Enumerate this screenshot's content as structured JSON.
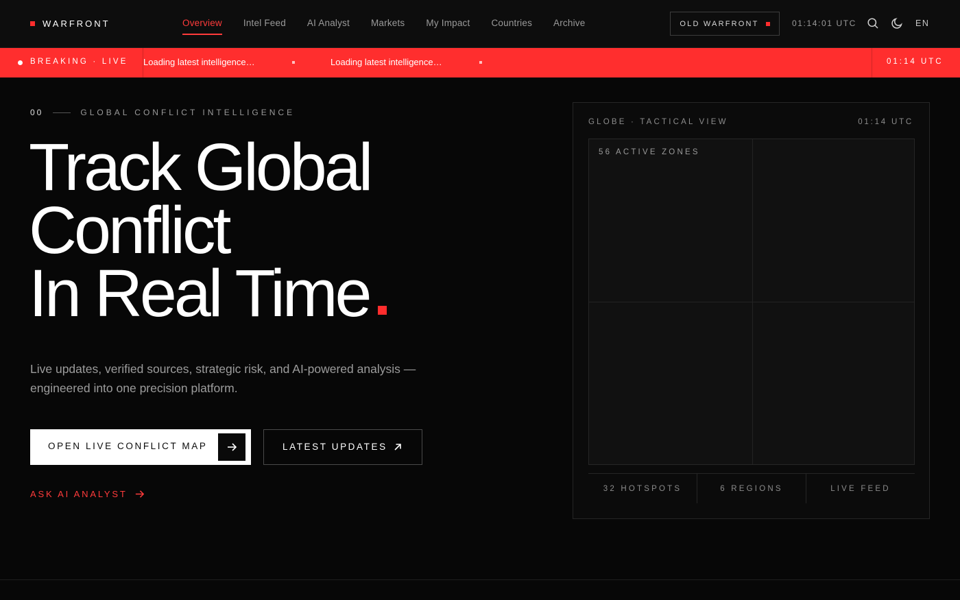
{
  "colors": {
    "accent": "#ff2d2d",
    "background": "#070707",
    "ticker_bg": "#ff2e2e"
  },
  "nav": {
    "brand": "WARFRONT",
    "links": [
      {
        "label": "Overview",
        "active": true
      },
      {
        "label": "Intel Feed",
        "active": false
      },
      {
        "label": "AI Analyst",
        "active": false
      },
      {
        "label": "Markets",
        "active": false
      },
      {
        "label": "My Impact",
        "active": false
      },
      {
        "label": "Countries",
        "active": false
      },
      {
        "label": "Archive",
        "active": false
      }
    ],
    "old_site_button": "OLD WARFRONT",
    "clock": "01:14:01 UTC",
    "icons": [
      "search-icon",
      "moon-icon"
    ],
    "language": "EN"
  },
  "ticker": {
    "label": "BREAKING · LIVE",
    "messages": [
      "Loading latest intelligence…",
      "Loading latest intelligence…"
    ],
    "time": "01:14 UTC"
  },
  "hero": {
    "eyebrow_number": "00",
    "eyebrow_text": "GLOBAL CONFLICT INTELLIGENCE",
    "title_lines": [
      "Track Global",
      "Conflict",
      "In Real Time"
    ],
    "subtitle": "Live updates, verified sources, strategic risk, and AI-powered analysis — engineered into one precision platform.",
    "primary_cta": "OPEN LIVE CONFLICT MAP",
    "secondary_cta": "LATEST UPDATES",
    "tertiary_cta": "ASK AI ANALYST"
  },
  "globe_panel": {
    "title": "GLOBE · TACTICAL VIEW",
    "time": "01:14 UTC",
    "active_zones": "56 ACTIVE ZONES",
    "stats": [
      "32 HOTSPOTS",
      "6 REGIONS",
      "LIVE FEED"
    ]
  }
}
